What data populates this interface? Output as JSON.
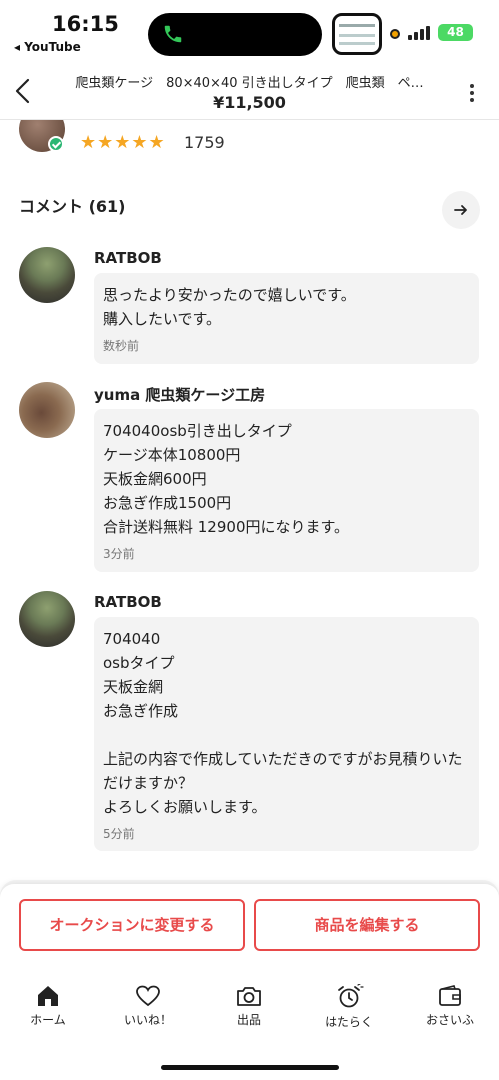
{
  "status_bar": {
    "time": "16:15",
    "back_app": "◂ YouTube",
    "battery": "48",
    "accent_call": "#34c759"
  },
  "header": {
    "title": "爬虫類ケージ　80×40×40 引き出しタイプ　爬虫類　ペ…",
    "price": "¥11,500"
  },
  "seller": {
    "name": "yuma 爬虫類ケージ工房",
    "stars": "★★★★★",
    "rating_count": "1759"
  },
  "comments_section": {
    "heading": "コメント (61)",
    "items": [
      {
        "author": "RATBOB",
        "text": "思ったより安かったので嬉しいです。\n購入したいです。",
        "time": "数秒前"
      },
      {
        "author": "yuma 爬虫類ケージ工房",
        "text": "704040osb引き出しタイプ\nケージ本体10800円\n天板金網600円\nお急ぎ作成1500円\n合計送料無料 12900円になります。",
        "time": "3分前"
      },
      {
        "author": "RATBOB",
        "text": "704040\nosbタイプ\n天板金網\nお急ぎ作成\n\n上記の内容で作成していただきのですがお見積りいただけますか？\nよろしくお願いします。",
        "time": "5分前"
      }
    ]
  },
  "actions": {
    "auction_button": "オークションに変更する",
    "edit_button": "商品を編集する",
    "accent": "#e84a4a"
  },
  "tabbar": {
    "items": [
      {
        "label": "ホーム",
        "icon": "home-icon"
      },
      {
        "label": "いいね！",
        "icon": "heart-icon"
      },
      {
        "label": "出品",
        "icon": "camera-icon"
      },
      {
        "label": "はたらく",
        "icon": "alarm-clock-icon"
      },
      {
        "label": "おさいふ",
        "icon": "wallet-icon"
      }
    ]
  }
}
